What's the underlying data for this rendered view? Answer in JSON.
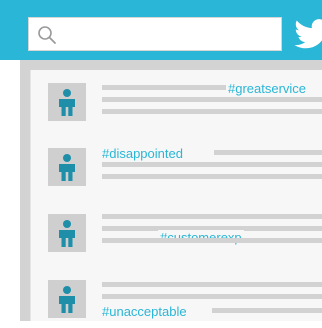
{
  "search": {
    "value": "",
    "placeholder": "",
    "icon": "search-icon"
  },
  "brand": {
    "icon": "twitter-bird-icon",
    "color": "#2ab6d6"
  },
  "feed": {
    "items": [
      {
        "hashtag": "#greatservice"
      },
      {
        "hashtag": "#disappointed"
      },
      {
        "hashtag": "#customerexp"
      },
      {
        "hashtag": "#unacceptable"
      }
    ]
  },
  "colors": {
    "accent": "#2ab6d6",
    "panel": "#d3d3d3",
    "feed_bg": "#f7f7f7",
    "text_line": "#d2d2d2",
    "avatar_bg": "#cfcfcf",
    "avatar_figure": "#1f8ea8"
  }
}
